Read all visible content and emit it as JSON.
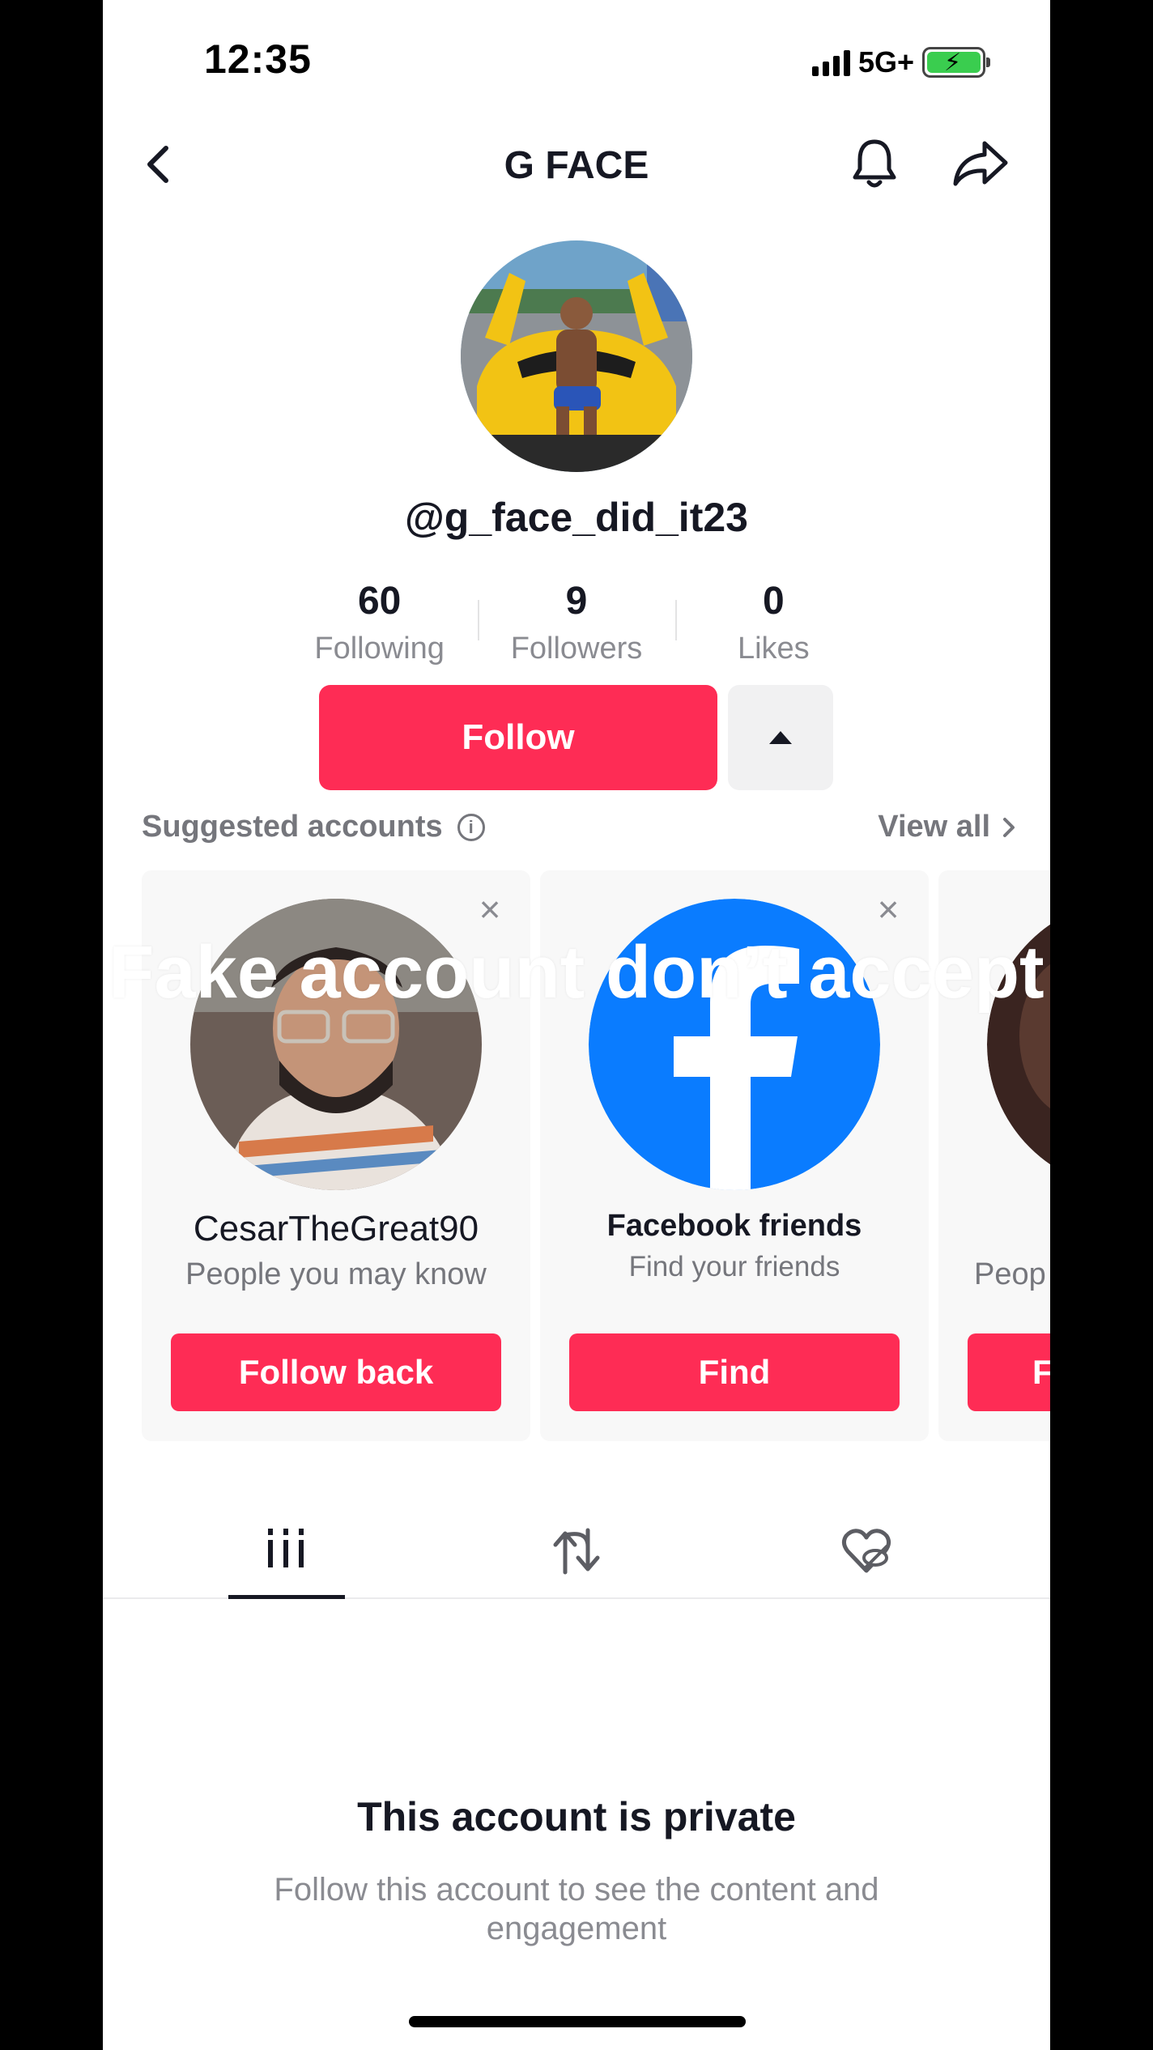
{
  "status_bar": {
    "time": "12:35",
    "network": "5G+"
  },
  "header": {
    "title": "G FACE"
  },
  "profile": {
    "username": "@g_face_did_it23",
    "stats": [
      {
        "value": "60",
        "label": "Following"
      },
      {
        "value": "9",
        "label": "Followers"
      },
      {
        "value": "0",
        "label": "Likes"
      }
    ],
    "follow_label": "Follow"
  },
  "suggested": {
    "title": "Suggested accounts",
    "view_all": "View all",
    "cards": [
      {
        "name": "CesarTheGreat90",
        "subtitle": "People you may know",
        "button": "Follow back"
      },
      {
        "name": "Facebook friends",
        "subtitle": "Find your friends",
        "button": "Find"
      },
      {
        "name": "",
        "subtitle": "Peop",
        "button": "F"
      }
    ]
  },
  "overlay_caption": "Fake account don’t accept",
  "private": {
    "title": "This account is private",
    "description": "Follow this account to see the content and engagement"
  },
  "colors": {
    "accent": "#fe2c55",
    "text": "#161823",
    "muted": "#8a8b91"
  },
  "icons": [
    "back-chevron-icon",
    "bell-icon",
    "share-arrow-icon",
    "info-icon",
    "chevron-right-icon",
    "close-icon",
    "facebook-logo-icon",
    "videos-grid-icon",
    "repost-icon",
    "liked-hidden-icon"
  ]
}
